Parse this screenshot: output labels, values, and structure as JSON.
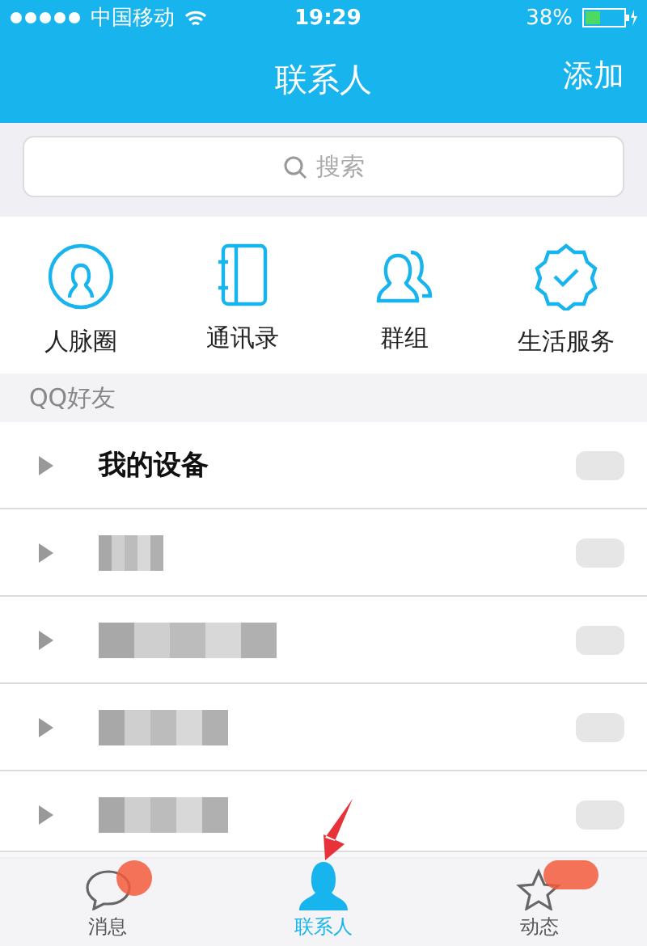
{
  "status_bar": {
    "carrier": "中国移动",
    "time": "19:29",
    "battery": "38%"
  },
  "nav": {
    "title": "联系人",
    "action": "添加"
  },
  "search": {
    "placeholder": "搜索"
  },
  "shortcuts": [
    {
      "kind": "circle-person",
      "label": "人脉圈"
    },
    {
      "kind": "notebook",
      "label": "通讯录"
    },
    {
      "kind": "people",
      "label": "群组"
    },
    {
      "kind": "badge-check",
      "label": "生活服务"
    }
  ],
  "section": {
    "title": "QQ好友"
  },
  "groups": [
    {
      "kind": "text",
      "name": "我的设备"
    },
    {
      "kind": "blurred"
    },
    {
      "kind": "blurred"
    },
    {
      "kind": "blurred"
    },
    {
      "kind": "blurred"
    }
  ],
  "tabs": [
    {
      "kind": "chat",
      "label": "消息",
      "selected": false,
      "badge": true
    },
    {
      "kind": "contact",
      "label": "联系人",
      "selected": true,
      "badge": false
    },
    {
      "kind": "star",
      "label": "动态",
      "selected": false,
      "badge": true
    }
  ],
  "annotation": {
    "kind": "arrow"
  }
}
